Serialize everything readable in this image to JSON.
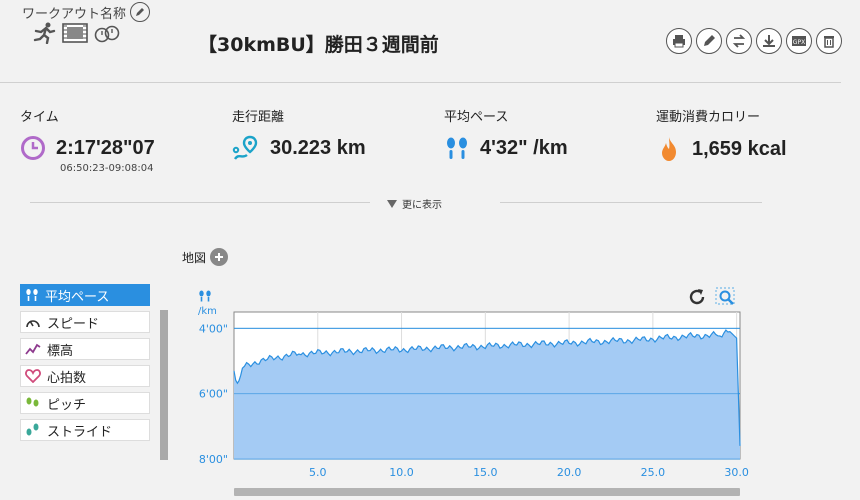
{
  "header": {
    "workout_name_label": "ワークアウト名称",
    "title": "【30kmBU】勝田３週間前",
    "type_icons": [
      "runner-icon",
      "video-icon",
      "stopwatch-icon"
    ],
    "toolbar": [
      "print-icon",
      "edit-icon",
      "swap-icon",
      "download-icon",
      "gpx-icon",
      "trash-icon"
    ]
  },
  "stats": [
    {
      "label": "タイム",
      "value": "2:17'28\"07",
      "sub": "06:50:23-09:08:04",
      "icon": "clock-icon",
      "color": "#b06ac9"
    },
    {
      "label": "走行距離",
      "value": "30.223 km",
      "icon": "route-pin-icon",
      "color": "#1ba3c9"
    },
    {
      "label": "平均ペース",
      "value": "4'32\" /km",
      "icon": "footprints-icon",
      "color": "#2a8fe0"
    },
    {
      "label": "運動消費カロリー",
      "value": "1,659 kcal",
      "icon": "flame-icon",
      "color": "#f28a30"
    }
  ],
  "more": {
    "label": "更に表示"
  },
  "map": {
    "label": "地図"
  },
  "metrics": [
    {
      "label": "平均ペース",
      "icon": "footprints-icon",
      "active": true
    },
    {
      "label": "スピード",
      "icon": "speedometer-icon",
      "active": false
    },
    {
      "label": "標高",
      "icon": "elevation-icon",
      "active": false
    },
    {
      "label": "心拍数",
      "icon": "heart-icon",
      "active": false
    },
    {
      "label": "ピッチ",
      "icon": "cadence-icon",
      "active": false
    },
    {
      "label": "ストライド",
      "icon": "stride-icon",
      "active": false
    }
  ],
  "colors": {
    "accent": "#2a8fe0",
    "area_fill": "#a4cbf4"
  },
  "chart_data": {
    "type": "area",
    "xlabel": "",
    "ylabel": "/km",
    "xlim": [
      0,
      30.2
    ],
    "ylim": [
      8.0,
      3.5
    ],
    "y_inverted": true,
    "xticks": [
      "5.0",
      "10.0",
      "15.0",
      "20.0",
      "25.0",
      "30.0"
    ],
    "xtick_values": [
      5,
      10,
      15,
      20,
      25,
      30
    ],
    "yticks": [
      "4'00\"",
      "6'00\"",
      "8'00\""
    ],
    "ytick_values": [
      4,
      6,
      8
    ],
    "x": [
      0,
      0.2,
      0.5,
      1,
      1.5,
      2,
      2.5,
      3,
      3.5,
      4,
      5,
      6,
      7,
      8,
      9,
      10,
      11,
      12,
      13,
      14,
      15,
      16,
      17,
      18,
      19,
      20,
      21,
      22,
      23,
      24,
      25,
      26,
      27,
      28,
      29,
      29.6,
      30.0,
      30.2
    ],
    "values": [
      5.3,
      5.7,
      5.2,
      5.1,
      5.0,
      4.95,
      4.9,
      4.85,
      4.8,
      4.78,
      4.75,
      4.72,
      4.7,
      4.68,
      4.66,
      4.65,
      4.63,
      4.6,
      4.58,
      4.56,
      4.55,
      4.52,
      4.5,
      4.48,
      4.46,
      4.45,
      4.42,
      4.4,
      4.38,
      4.36,
      4.32,
      4.28,
      4.25,
      4.22,
      4.2,
      4.1,
      4.3,
      7.6
    ],
    "grid": true
  }
}
